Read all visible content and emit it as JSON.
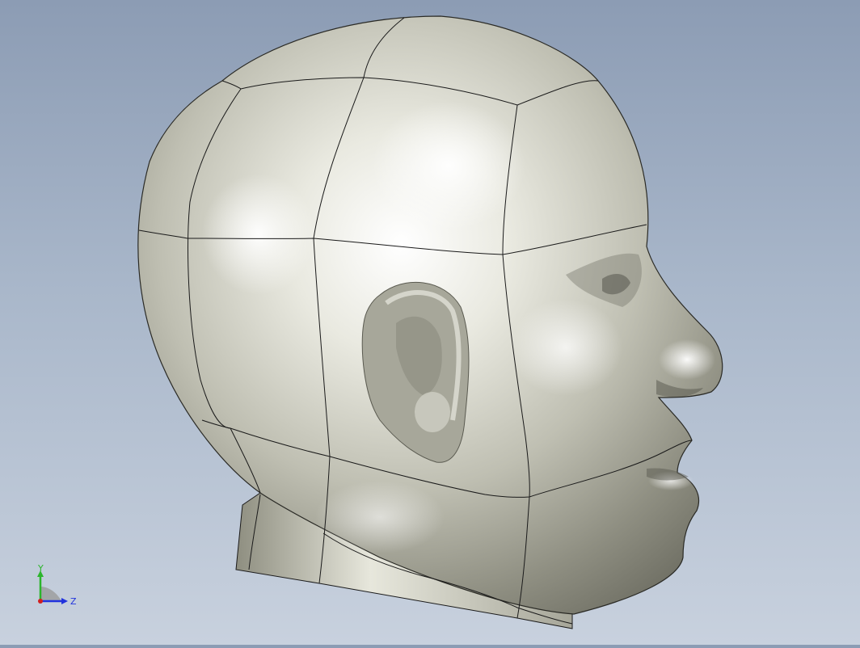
{
  "viewport": {
    "background_top": "#8c9cb4",
    "background_bottom": "#c8d1de",
    "model": {
      "name": "head",
      "surface_color": "#b9b9ac",
      "edge_color": "#1a1a1a"
    }
  },
  "triad": {
    "y_label": "Y",
    "z_label": "Z",
    "y_color": "#2bb52b",
    "z_color": "#2233dd",
    "x_color": "#d11f1f"
  }
}
